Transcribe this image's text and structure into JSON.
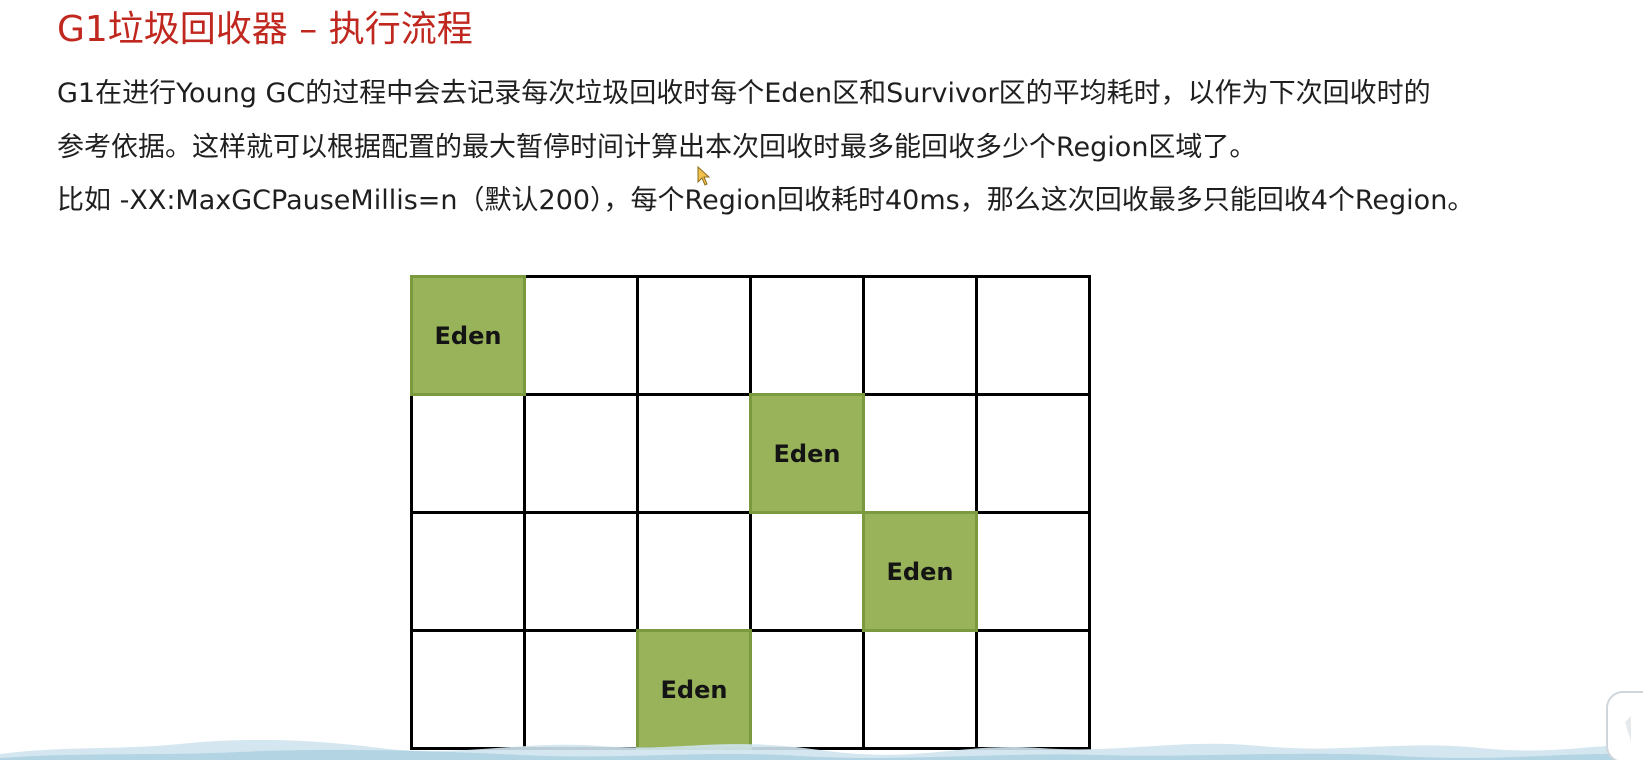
{
  "slide": {
    "title": "G1垃圾回收器 – 执行流程",
    "lines": [
      "G1在进行Young GC的过程中会去记录每次垃圾回收时每个Eden区和Survivor区的平均耗时，以作为下次回收时的",
      "参考依据。这样就可以根据配置的最大暂停时间计算出本次回收时最多能回收多少个Region区域了。",
      "比如 -XX:MaxGCPauseMillis=n（默认200），每个Region回收耗时40ms，那么这次回收最多只能回收4个Region。"
    ]
  },
  "diagram": {
    "columns": 6,
    "rows": 4,
    "eden_label": "Eden",
    "eden_cells": [
      {
        "row": 0,
        "col": 0
      },
      {
        "row": 1,
        "col": 3
      },
      {
        "row": 2,
        "col": 4
      },
      {
        "row": 3,
        "col": 2
      }
    ],
    "colors": {
      "eden_fill": "#98b35a",
      "grid_line": "#000000",
      "title": "#c0281f"
    }
  }
}
